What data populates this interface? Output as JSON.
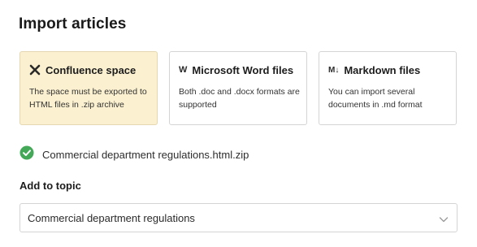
{
  "page_title": "Import articles",
  "sources": [
    {
      "icon": "confluence-icon",
      "title": "Confluence space",
      "description": "The space must be exported to HTML files in .zip archive",
      "selected": true
    },
    {
      "icon": "word-icon",
      "icon_glyph": "W",
      "title": "Microsoft Word files",
      "description": "Both .doc and .docx formats are supported",
      "selected": false
    },
    {
      "icon": "markdown-icon",
      "icon_glyph": "M↓",
      "title": "Markdown files",
      "description": "You can import several documents in .md format",
      "selected": false
    }
  ],
  "uploaded_file": {
    "status_icon": "check-circle-icon",
    "name": "Commercial department regulations.html.zip"
  },
  "topic": {
    "label": "Add to topic",
    "selected_value": "Commercial department regulations"
  },
  "colors": {
    "selected_card_bg": "#fbf0cf",
    "success_green": "#43a857"
  }
}
